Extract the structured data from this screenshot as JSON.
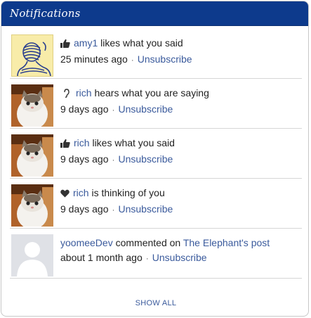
{
  "header": {
    "title": "Notifications"
  },
  "notifications": [
    {
      "icon": "thumbs-up-icon",
      "user": "amy1",
      "action": "likes what you said",
      "time": "25 minutes ago",
      "unsubscribe": "Unsubscribe",
      "avatar": "sketch-avatar"
    },
    {
      "icon": "ear-icon",
      "user": "rich",
      "action": "hears what you are saying",
      "time": "9 days ago",
      "unsubscribe": "Unsubscribe",
      "avatar": "cat-avatar"
    },
    {
      "icon": "thumbs-up-icon",
      "user": "rich",
      "action": "likes what you said",
      "time": "9 days ago",
      "unsubscribe": "Unsubscribe",
      "avatar": "cat-avatar"
    },
    {
      "icon": "heart-icon",
      "user": "rich",
      "action": "is thinking of you",
      "time": "9 days ago",
      "unsubscribe": "Unsubscribe",
      "avatar": "cat-avatar"
    },
    {
      "user": "yoomeeDev",
      "action": "commented on",
      "target": "The Elephant's post",
      "time": "about 1 month ago",
      "unsubscribe": "Unsubscribe",
      "avatar": "default-avatar"
    }
  ],
  "separator": "·",
  "footer": {
    "show_all": "SHOW ALL"
  },
  "colors": {
    "header_bg": "#0d3a8c",
    "link": "#3a5a9c",
    "text": "#222222"
  }
}
